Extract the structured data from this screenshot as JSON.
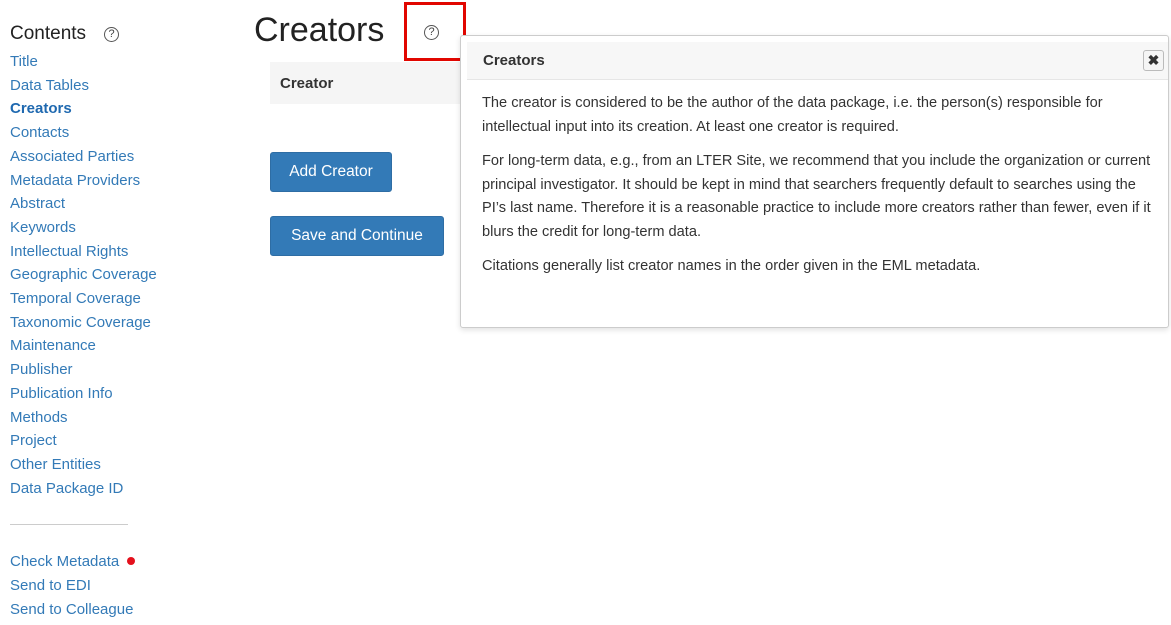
{
  "sidebar": {
    "title": "Contents",
    "help_glyph": "?",
    "nav_items": [
      {
        "label": "Title"
      },
      {
        "label": "Data Tables"
      },
      {
        "label": "Creators"
      },
      {
        "label": "Contacts"
      },
      {
        "label": "Associated Parties"
      },
      {
        "label": "Metadata Providers"
      },
      {
        "label": "Abstract"
      },
      {
        "label": "Keywords"
      },
      {
        "label": "Intellectual Rights"
      },
      {
        "label": "Geographic Coverage"
      },
      {
        "label": "Temporal Coverage"
      },
      {
        "label": "Taxonomic Coverage"
      },
      {
        "label": "Maintenance"
      },
      {
        "label": "Publisher"
      },
      {
        "label": "Publication Info"
      },
      {
        "label": "Methods"
      },
      {
        "label": "Project"
      },
      {
        "label": "Other Entities"
      },
      {
        "label": "Data Package ID"
      }
    ],
    "actions": [
      {
        "label": "Check Metadata"
      },
      {
        "label": "Send to EDI"
      },
      {
        "label": "Send to Colleague"
      }
    ],
    "status_dot_color": "#e4101c"
  },
  "main": {
    "title": "Creators",
    "help_glyph": "?",
    "table_header": "Creator",
    "add_button": "Add Creator",
    "save_button": "Save and Continue",
    "accent_color": "#337ab7"
  },
  "popover": {
    "title": "Creators",
    "close_glyph": "✖",
    "paragraphs": [
      "The creator is considered to be the author of the data package, i.e. the person(s) responsible for intellectual input into its creation. At least one creator is required.",
      "For long-term data, e.g., from an LTER Site, we recommend that you include the organization or current principal investigator. It should be kept in mind that searchers frequently default to searches using the PI’s last name. Therefore it is a reasonable practice to include more creators rather than fewer, even if it blurs the credit for long-term data.",
      "Citations generally list creator names in the order given in the EML metadata."
    ]
  },
  "highlight_color": "#e10600"
}
